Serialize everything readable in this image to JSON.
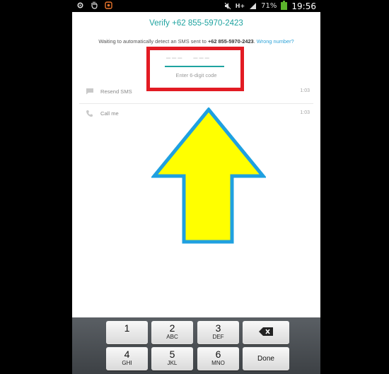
{
  "status_bar": {
    "battery": "71%",
    "time": "19:56",
    "network": "H+",
    "icons": [
      "gear-icon",
      "hand-icon",
      "orange-app-icon",
      "mute-icon",
      "signal-icon",
      "battery-icon"
    ]
  },
  "verify": {
    "title": "Verify +62 855-5970-2423",
    "subtitle_pre": "Waiting to automatically detect an SMS sent to ",
    "subtitle_number": "+62 855-5970-2423",
    "subtitle_post": ". ",
    "wrong_number": "Wrong number?",
    "code_dashes_left": "–––",
    "code_dashes_right": "–––",
    "code_hint": "Enter 6-digit code"
  },
  "options": [
    {
      "label": "Resend SMS",
      "time": "1:03",
      "icon": "message-icon"
    },
    {
      "label": "Call me",
      "time": "1:03",
      "icon": "phone-icon"
    }
  ],
  "keyboard": {
    "row1": [
      {
        "num": "1",
        "letters": ""
      },
      {
        "num": "2",
        "letters": "ABC"
      },
      {
        "num": "3",
        "letters": "DEF"
      }
    ],
    "row2": [
      {
        "num": "4",
        "letters": "GHI"
      },
      {
        "num": "5",
        "letters": "JKL"
      },
      {
        "num": "6",
        "letters": "MNO"
      }
    ],
    "done_label": "Done"
  },
  "colors": {
    "accent": "#1fa3a0",
    "link": "#2ea3d8",
    "annotation_red": "#e21b23",
    "arrow_fill": "#ffff00",
    "arrow_stroke": "#1fa0e0"
  }
}
